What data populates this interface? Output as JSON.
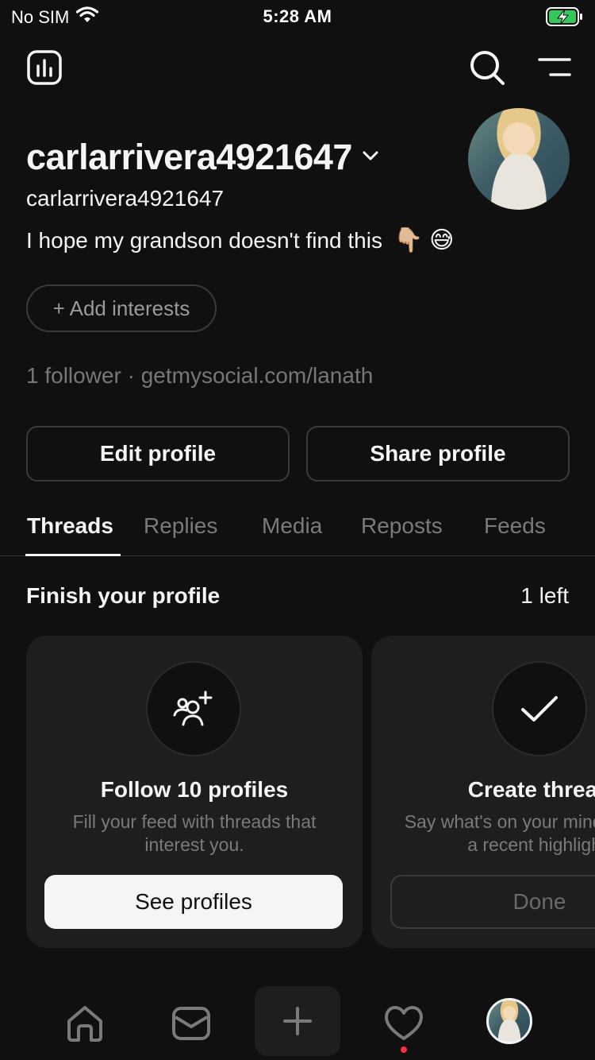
{
  "status_bar": {
    "carrier": "No SIM",
    "time": "5:28 AM",
    "icons": [
      "wifi-icon",
      "battery-charging-icon"
    ]
  },
  "header": {
    "icons": [
      "insights-icon",
      "search-icon",
      "menu-icon"
    ]
  },
  "profile": {
    "display_name": "carlarrivera4921647",
    "handle": "carlarrivera4921647",
    "bio": "I hope my grandson doesn't find this",
    "bio_emojis": [
      "👇🏼",
      "😅"
    ],
    "add_interests_label": "+ Add interests",
    "followers_line": "1 follower · getmysocial.com/lanath",
    "edit_profile_label": "Edit profile",
    "share_profile_label": "Share profile"
  },
  "tabs": [
    {
      "label": "Threads",
      "active": true
    },
    {
      "label": "Replies",
      "active": false
    },
    {
      "label": "Media",
      "active": false
    },
    {
      "label": "Reposts",
      "active": false
    },
    {
      "label": "Feeds",
      "active": false
    }
  ],
  "finish_profile": {
    "title": "Finish your profile",
    "remaining": "1 left",
    "cards": [
      {
        "icon": "add-people-icon",
        "title": "Follow 10 profiles",
        "desc_line1": "Fill your feed with threads that",
        "desc_line2": "interest you.",
        "button_label": "See profiles",
        "done": false
      },
      {
        "icon": "checkmark-icon",
        "title": "Create thread",
        "desc_line1": "Say what's on your mind or share",
        "desc_line2": "a recent highlight.",
        "button_label": "Done",
        "done": true
      }
    ]
  },
  "bottom_nav": {
    "items": [
      "home-icon",
      "inbox-icon",
      "create-icon",
      "activity-icon",
      "profile-avatar"
    ],
    "activity_badge_color": "#ff3040"
  },
  "colors": {
    "background": "#101010",
    "card": "#1e1e1e",
    "text_primary": "#f3f5f7",
    "text_muted": "#7a7a7a"
  }
}
